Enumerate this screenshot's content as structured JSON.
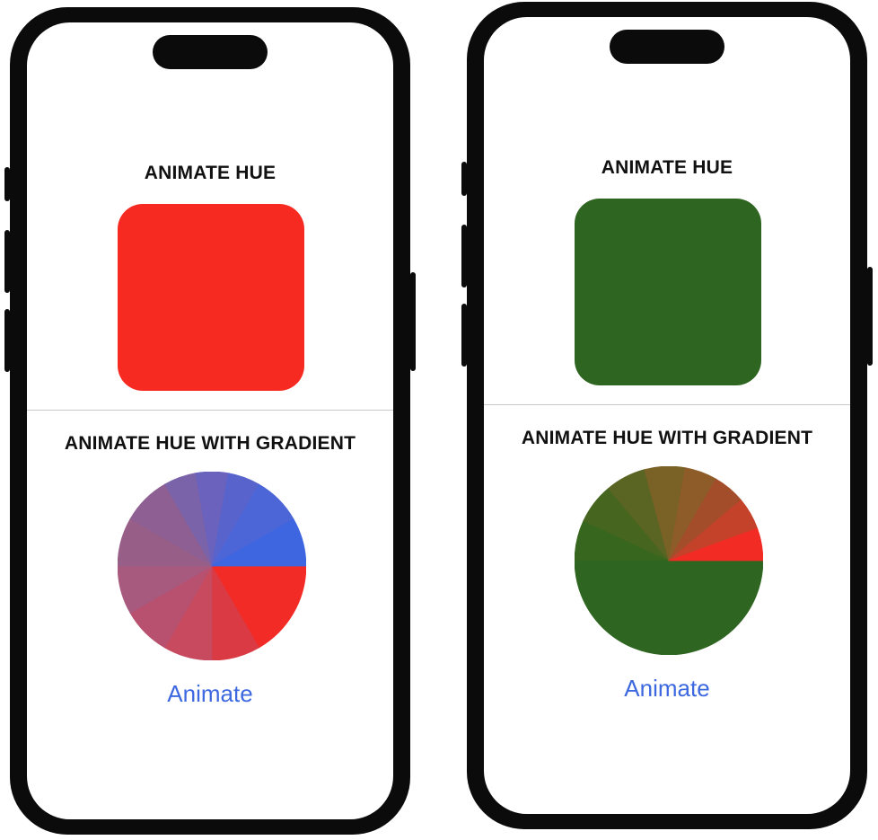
{
  "phones": [
    {
      "title_hue": "ANIMATE HUE",
      "title_gradient": "ANIMATE HUE WITH GRADIENT",
      "square_color": "#f72a22",
      "pie_slices": [
        {
          "from": 0,
          "to": 60,
          "color": "#f22b26"
        },
        {
          "from": 60,
          "to": 90,
          "color": "#da3a44"
        },
        {
          "from": 90,
          "to": 120,
          "color": "#c74a5f"
        },
        {
          "from": 120,
          "to": 150,
          "color": "#b8506f"
        },
        {
          "from": 150,
          "to": 180,
          "color": "#a85a7e"
        },
        {
          "from": 180,
          "to": 210,
          "color": "#975f88"
        },
        {
          "from": 210,
          "to": 240,
          "color": "#8e5f93"
        },
        {
          "from": 240,
          "to": 260,
          "color": "#7a63a8"
        },
        {
          "from": 260,
          "to": 280,
          "color": "#6a62bd"
        },
        {
          "from": 280,
          "to": 300,
          "color": "#5864cc"
        },
        {
          "from": 300,
          "to": 330,
          "color": "#4c66d8"
        },
        {
          "from": 330,
          "to": 360,
          "color": "#3e66e0"
        }
      ],
      "button_label": "Animate",
      "button_color": "#3d68e0"
    },
    {
      "title_hue": "ANIMATE HUE",
      "title_gradient": "ANIMATE HUE WITH GRADIENT",
      "square_color": "#2e6521",
      "pie_slices": [
        {
          "from": 0,
          "to": 180,
          "color": "#2e6521"
        },
        {
          "from": 180,
          "to": 205,
          "color": "#37661f"
        },
        {
          "from": 205,
          "to": 230,
          "color": "#46651f"
        },
        {
          "from": 230,
          "to": 255,
          "color": "#5a6423"
        },
        {
          "from": 255,
          "to": 280,
          "color": "#7a6126"
        },
        {
          "from": 280,
          "to": 300,
          "color": "#8e5c29"
        },
        {
          "from": 300,
          "to": 320,
          "color": "#a34d2b"
        },
        {
          "from": 320,
          "to": 340,
          "color": "#c4412a"
        },
        {
          "from": 340,
          "to": 360,
          "color": "#f22b24"
        }
      ],
      "button_label": "Animate",
      "button_color": "#3d68e0"
    }
  ]
}
